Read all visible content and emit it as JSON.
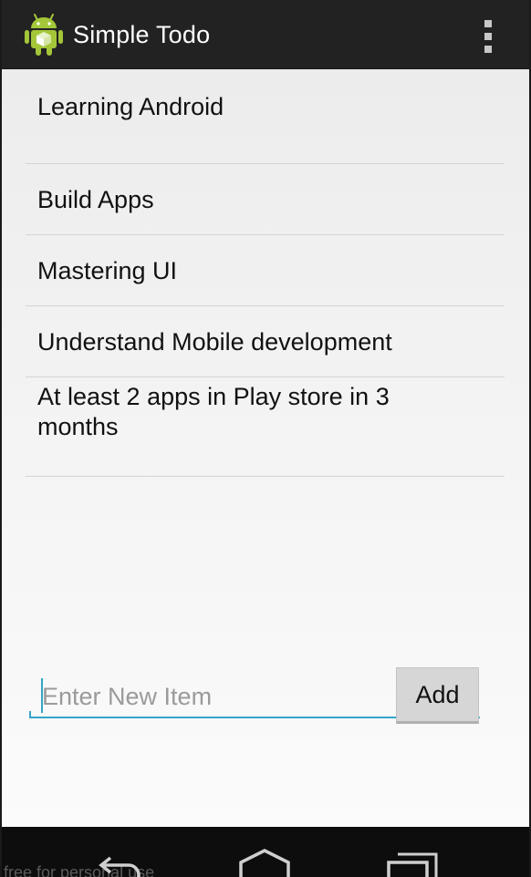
{
  "app": {
    "title": "Simple Todo",
    "icon": "android-robot-icon",
    "overflow_icon": "overflow-menu-icon"
  },
  "todos": [
    {
      "text": "Learning Android"
    },
    {
      "text": "Build Apps"
    },
    {
      "text": "Mastering UI"
    },
    {
      "text": "Understand Mobile development"
    },
    {
      "text": "At least 2 apps in Play store in 3 months"
    }
  ],
  "new_item": {
    "value": "",
    "placeholder": "Enter New Item"
  },
  "add_button": {
    "label": "Add"
  },
  "nav": {
    "back_icon": "back-icon",
    "home_icon": "home-icon",
    "recents_icon": "recent-apps-icon"
  },
  "watermark": "free for personal use",
  "colors": {
    "action_bar": "#222222",
    "accent": "#33a5c8",
    "android_green": "#a4c639",
    "nav_bar": "#0d0d0d"
  }
}
